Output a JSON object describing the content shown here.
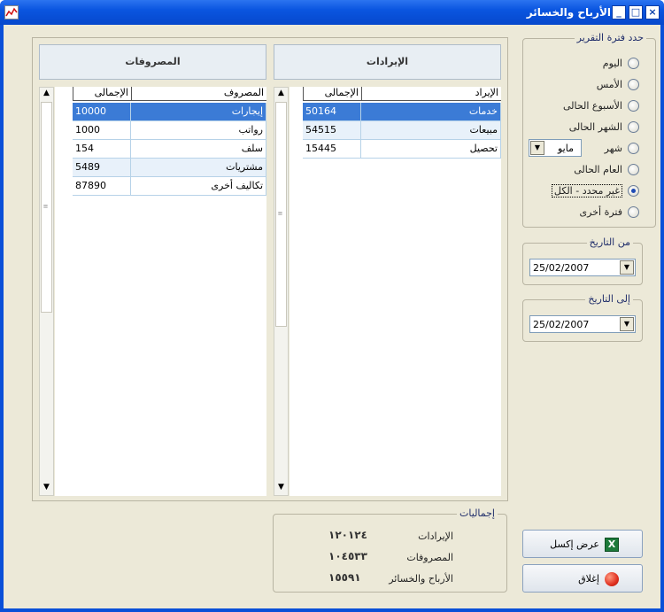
{
  "window": {
    "title": "الأرباح والخسائر",
    "btn_min": "_",
    "btn_max": "□",
    "btn_close": "×"
  },
  "period": {
    "legend": "حدد فترة التقرير",
    "options": [
      "اليوم",
      "الأمس",
      "الأسبوع الحالى",
      "الشهر الحالى",
      "شهر",
      "العام الحالى",
      "غير محدد - الكل",
      "فترة أخرى"
    ],
    "selected_index": 6,
    "month_value": "مايو"
  },
  "from_date": {
    "legend": "من التاريخ",
    "value": "25/02/2007"
  },
  "to_date": {
    "legend": "إلى التاريخ",
    "value": "25/02/2007"
  },
  "revenues": {
    "header": "الإيرادات",
    "columns": [
      "الإيراد",
      "الإجمالى"
    ],
    "rows": [
      {
        "name": "خدمات",
        "total": "50164"
      },
      {
        "name": "مبيعات",
        "total": "54515"
      },
      {
        "name": "تحصيل",
        "total": "15445"
      }
    ]
  },
  "expenses": {
    "header": "المصروفات",
    "columns": [
      "المصروف",
      "الإجمالى"
    ],
    "rows": [
      {
        "name": "إيجارات",
        "total": "10000"
      },
      {
        "name": "رواتب",
        "total": "1000"
      },
      {
        "name": "سلف",
        "total": "154"
      },
      {
        "name": "مشتريات",
        "total": "5489"
      },
      {
        "name": "تكاليف أخرى",
        "total": "87890"
      }
    ]
  },
  "summary": {
    "legend": "إجماليات",
    "revenues_label": "الإيرادات",
    "revenues_value": "١٢٠١٢٤",
    "expenses_label": "المصروفات",
    "expenses_value": "١٠٤٥٣٣",
    "profit_label": "الأرباح والخسائر",
    "profit_value": "١٥٥٩١"
  },
  "buttons": {
    "excel": "عرض إكسل",
    "close": "إغلاق"
  },
  "colors": {
    "selection": "#3b7bd6",
    "titlebar": "#0a55e0",
    "excel": "#1d7a3a",
    "close": "#e03020"
  }
}
